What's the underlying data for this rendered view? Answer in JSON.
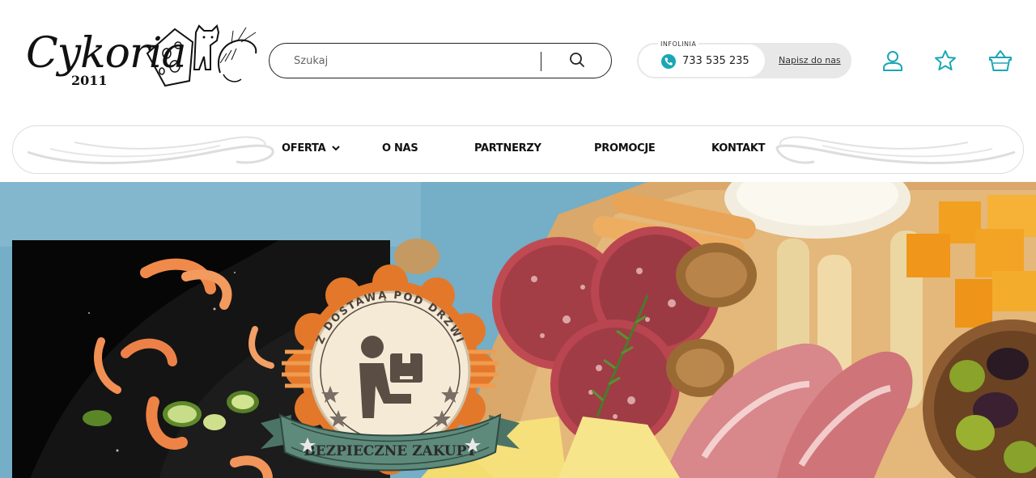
{
  "brand": {
    "name": "Cykoria",
    "year": "2011"
  },
  "search": {
    "placeholder": "Szukaj"
  },
  "contact": {
    "label": "INFOLINIA",
    "phone": "733 535 235",
    "write_link": "Napisz do nas"
  },
  "header_icons": [
    "user-icon",
    "star-icon",
    "basket-icon"
  ],
  "nav": {
    "items": [
      {
        "label": "OFERTA",
        "has_dropdown": true
      },
      {
        "label": "O NAS"
      },
      {
        "label": "PARTNERZY"
      },
      {
        "label": "PROMOCJE"
      },
      {
        "label": "KONTAKT"
      }
    ]
  },
  "hero": {
    "badge_top": "Z DOSTAWĄ POD DRZWI",
    "badge_ribbon": "BEZPIECZNE ZAKUPY"
  },
  "colors": {
    "accent": "#1aa7b5",
    "badge_orange": "#e4782a",
    "badge_ribbon": "#5e8a7b",
    "hero_bg": "#6fa9c2"
  }
}
